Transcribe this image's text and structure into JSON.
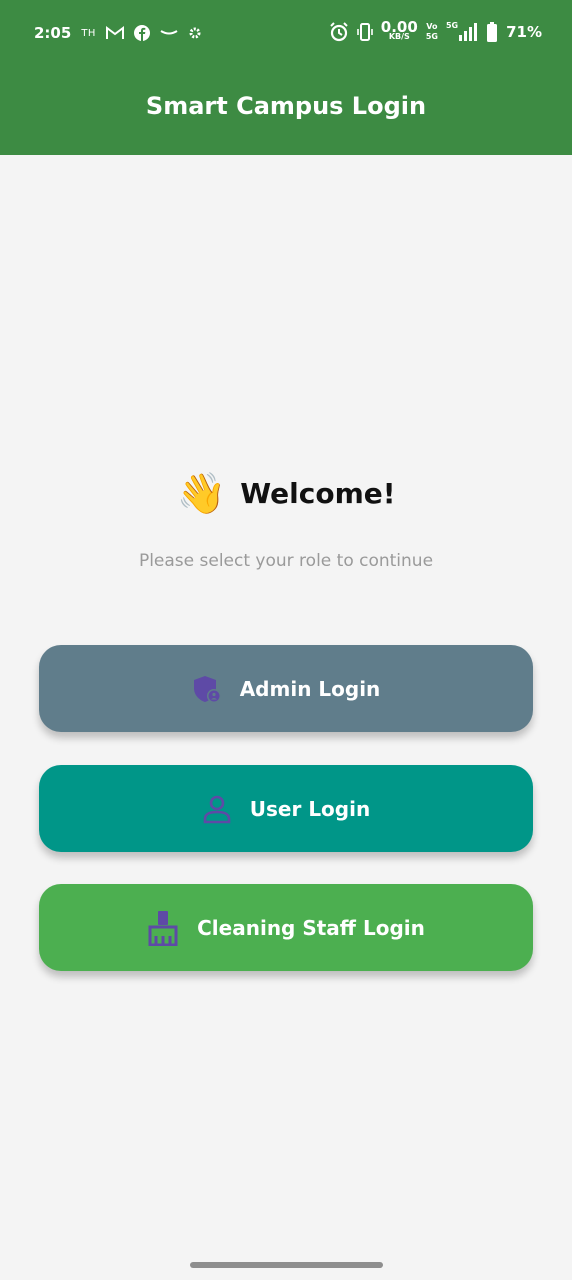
{
  "status_bar": {
    "time": "2:05",
    "carrier_small": "TH",
    "net_speed": "0.00",
    "net_unit": "KB/S",
    "volte_top": "Vo",
    "volte_bottom": "5G",
    "network": "5G",
    "battery": "71%",
    "icons_left": [
      "gmail-icon",
      "facebook-icon",
      "amazon-icon",
      "settings-icon"
    ],
    "icons_right": [
      "alarm-icon",
      "vibrate-icon",
      "signal-icon",
      "battery-icon"
    ]
  },
  "app_bar": {
    "title": "Smart Campus Login",
    "color": "#3d8b43"
  },
  "welcome": {
    "emoji": "👋",
    "heading": "Welcome!",
    "subtitle": "Please select your role to continue"
  },
  "buttons": [
    {
      "label": "Admin Login",
      "icon": "admin-shield-icon",
      "color": "#607d8b"
    },
    {
      "label": "User Login",
      "icon": "person-icon",
      "color": "#009688"
    },
    {
      "label": "Cleaning Staff Login",
      "icon": "broom-icon",
      "color": "#4caf50"
    }
  ],
  "icon_color": "#5e4aa6"
}
